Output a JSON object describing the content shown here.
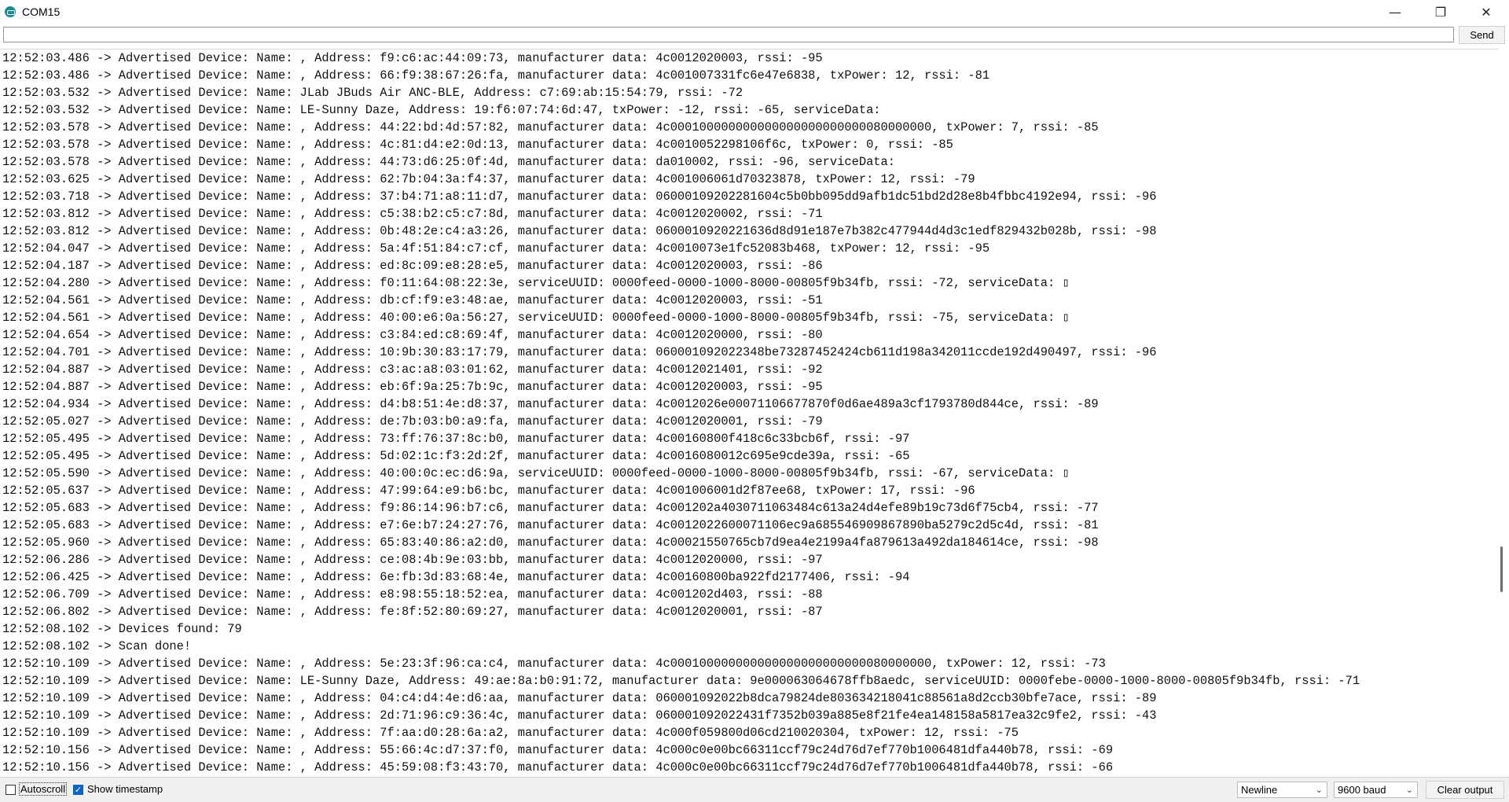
{
  "window": {
    "title": "COM15",
    "icon": "arduino-icon",
    "minimize_glyph": "—",
    "restore_glyph": "❐",
    "close_glyph": "✕"
  },
  "send": {
    "input_value": "",
    "button_label": "Send"
  },
  "output_lines": [
    "12:52:03.486 -> Advertised Device: Name: , Address: f9:c6:ac:44:09:73, manufacturer data: 4c0012020003, rssi: -95",
    "12:52:03.486 -> Advertised Device: Name: , Address: 66:f9:38:67:26:fa, manufacturer data: 4c001007331fc6e47e6838, txPower: 12, rssi: -81",
    "12:52:03.532 -> Advertised Device: Name: JLab JBuds Air ANC-BLE, Address: c7:69:ab:15:54:79, rssi: -72",
    "12:52:03.532 -> Advertised Device: Name: LE-Sunny Daze, Address: 19:f6:07:74:6d:47, txPower: -12, rssi: -65, serviceData:",
    "12:52:03.578 -> Advertised Device: Name: , Address: 44:22:bd:4d:57:82, manufacturer data: 4c000100000000000000000000000080000000, txPower: 7, rssi: -85",
    "12:52:03.578 -> Advertised Device: Name: , Address: 4c:81:d4:e2:0d:13, manufacturer data: 4c0010052298106f6c, txPower: 0, rssi: -85",
    "12:52:03.578 -> Advertised Device: Name: , Address: 44:73:d6:25:0f:4d, manufacturer data: da010002, rssi: -96, serviceData:",
    "12:52:03.625 -> Advertised Device: Name: , Address: 62:7b:04:3a:f4:37, manufacturer data: 4c001006061d70323878, txPower: 12, rssi: -79",
    "12:52:03.718 -> Advertised Device: Name: , Address: 37:b4:71:a8:11:d7, manufacturer data: 06000109202281604c5b0bb095dd9afb1dc51bd2d28e8b4fbbc4192e94, rssi: -96",
    "12:52:03.812 -> Advertised Device: Name: , Address: c5:38:b2:c5:c7:8d, manufacturer data: 4c0012020002, rssi: -71",
    "12:52:03.812 -> Advertised Device: Name: , Address: 0b:48:2e:c4:a3:26, manufacturer data: 0600010920221636d8d91e187e7b382c477944d4d3c1edf829432b028b, rssi: -98",
    "12:52:04.047 -> Advertised Device: Name: , Address: 5a:4f:51:84:c7:cf, manufacturer data: 4c0010073e1fc52083b468, txPower: 12, rssi: -95",
    "12:52:04.187 -> Advertised Device: Name: , Address: ed:8c:09:e8:28:e5, manufacturer data: 4c0012020003, rssi: -86",
    "12:52:04.280 -> Advertised Device: Name: , Address: f0:11:64:08:22:3e, serviceUUID: 0000feed-0000-1000-8000-00805f9b34fb, rssi: -72, serviceData: ▯",
    "12:52:04.561 -> Advertised Device: Name: , Address: db:cf:f9:e3:48:ae, manufacturer data: 4c0012020003, rssi: -51",
    "12:52:04.561 -> Advertised Device: Name: , Address: 40:00:e6:0a:56:27, serviceUUID: 0000feed-0000-1000-8000-00805f9b34fb, rssi: -75, serviceData: ▯",
    "12:52:04.654 -> Advertised Device: Name: , Address: c3:84:ed:c8:69:4f, manufacturer data: 4c0012020000, rssi: -80",
    "12:52:04.701 -> Advertised Device: Name: , Address: 10:9b:30:83:17:79, manufacturer data: 060001092022348be73287452424cb611d198a342011ccde192d490497, rssi: -96",
    "12:52:04.887 -> Advertised Device: Name: , Address: c3:ac:a8:03:01:62, manufacturer data: 4c0012021401, rssi: -92",
    "12:52:04.887 -> Advertised Device: Name: , Address: eb:6f:9a:25:7b:9c, manufacturer data: 4c0012020003, rssi: -95",
    "12:52:04.934 -> Advertised Device: Name: , Address: d4:b8:51:4e:d8:37, manufacturer data: 4c0012026e00071106677870f0d6ae489a3cf1793780d844ce, rssi: -89",
    "12:52:05.027 -> Advertised Device: Name: , Address: de:7b:03:b0:a9:fa, manufacturer data: 4c0012020001, rssi: -79",
    "12:52:05.495 -> Advertised Device: Name: , Address: 73:ff:76:37:8c:b0, manufacturer data: 4c00160800f418c6c33bcb6f, rssi: -97",
    "12:52:05.495 -> Advertised Device: Name: , Address: 5d:02:1c:f3:2d:2f, manufacturer data: 4c0016080012c695e9cde39a, rssi: -65",
    "12:52:05.590 -> Advertised Device: Name: , Address: 40:00:0c:ec:d6:9a, serviceUUID: 0000feed-0000-1000-8000-00805f9b34fb, rssi: -67, serviceData: ▯",
    "12:52:05.637 -> Advertised Device: Name: , Address: 47:99:64:e9:b6:bc, manufacturer data: 4c001006001d2f87ee68, txPower: 17, rssi: -96",
    "12:52:05.683 -> Advertised Device: Name: , Address: f9:86:14:96:b7:c6, manufacturer data: 4c001202a4030711063484c613a24d4efe89b19c73d6f75cb4, rssi: -77",
    "12:52:05.683 -> Advertised Device: Name: , Address: e7:6e:b7:24:27:76, manufacturer data: 4c0012022600071106ec9a685546909867890ba5279c2d5c4d, rssi: -81",
    "12:52:05.960 -> Advertised Device: Name: , Address: 65:83:40:86:a2:d0, manufacturer data: 4c00021550765cb7d9ea4e2199a4fa879613a492da184614ce, rssi: -98",
    "12:52:06.286 -> Advertised Device: Name: , Address: ce:08:4b:9e:03:bb, manufacturer data: 4c0012020000, rssi: -97",
    "12:52:06.425 -> Advertised Device: Name: , Address: 6e:fb:3d:83:68:4e, manufacturer data: 4c00160800ba922fd2177406, rssi: -94",
    "12:52:06.709 -> Advertised Device: Name: , Address: e8:98:55:18:52:ea, manufacturer data: 4c001202d403, rssi: -88",
    "12:52:06.802 -> Advertised Device: Name: , Address: fe:8f:52:80:69:27, manufacturer data: 4c0012020001, rssi: -87",
    "12:52:08.102 -> Devices found: 79",
    "12:52:08.102 -> Scan done!",
    "12:52:10.109 -> Advertised Device: Name: , Address: 5e:23:3f:96:ca:c4, manufacturer data: 4c000100000000000000000000000080000000, txPower: 12, rssi: -73",
    "12:52:10.109 -> Advertised Device: Name: LE-Sunny Daze, Address: 49:ae:8a:b0:91:72, manufacturer data: 9e000063064678ffb8aedc, serviceUUID: 0000febe-0000-1000-8000-00805f9b34fb, rssi: -71",
    "12:52:10.109 -> Advertised Device: Name: , Address: 04:c4:d4:4e:d6:aa, manufacturer data: 060001092022b8dca79824de803634218041c88561a8d2ccb30bfe7ace, rssi: -89",
    "12:52:10.109 -> Advertised Device: Name: , Address: 2d:71:96:c9:36:4c, manufacturer data: 060001092022431f7352b039a885e8f21fe4ea148158a5817ea32c9fe2, rssi: -43",
    "12:52:10.109 -> Advertised Device: Name: , Address: 7f:aa:d0:28:6a:a2, manufacturer data: 4c000f059800d06cd210020304, txPower: 12, rssi: -75",
    "12:52:10.156 -> Advertised Device: Name: , Address: 55:66:4c:d7:37:f0, manufacturer data: 4c000c0e00bc66311ccf79c24d76d7ef770b1006481dfa440b78, rssi: -69",
    "12:52:10.156 -> Advertised Device: Name: , Address: 45:59:08:f3:43:70, manufacturer data: 4c000c0e00bc66311ccf79c24d76d7ef770b1006481dfa440b78, rssi: -66"
  ],
  "bottom": {
    "autoscroll_label": "Autoscroll",
    "autoscroll_checked": false,
    "timestamp_label": "Show timestamp",
    "timestamp_checked": true,
    "line_ending": "Newline",
    "baud": "9600 baud",
    "clear_label": "Clear output"
  },
  "colors": {
    "accent": "#0a64c8",
    "app_icon": "#1a8a93"
  }
}
